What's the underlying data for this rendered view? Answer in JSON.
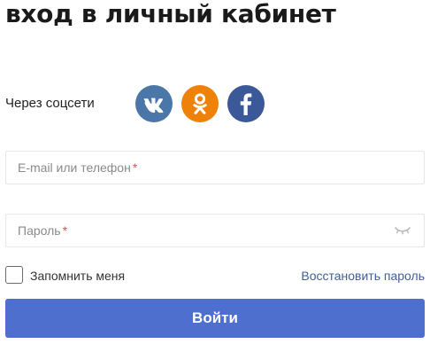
{
  "page": {
    "title": "вход в личный кабинет"
  },
  "social": {
    "label": "Через соцсети",
    "buttons": [
      {
        "name": "vk",
        "icon": "vk-icon",
        "color": "#4a76a8"
      },
      {
        "name": "odnoklassniki",
        "icon": "odnoklassniki-icon",
        "color": "#ee8208"
      },
      {
        "name": "facebook",
        "icon": "facebook-icon",
        "color": "#3b5998"
      }
    ]
  },
  "form": {
    "login": {
      "value": "",
      "placeholder": "E-mail или телефон",
      "required_mark": "*"
    },
    "password": {
      "value": "",
      "placeholder": "Пароль",
      "required_mark": "*",
      "toggle_icon": "eye-closed-icon"
    },
    "remember": {
      "label": "Запомнить меня",
      "checked": false
    },
    "restore_link": "Восстановить пароль",
    "submit_label": "Войти"
  },
  "colors": {
    "accent": "#4e6fcd",
    "link": "#3d5f9e",
    "required": "#e0505a"
  }
}
